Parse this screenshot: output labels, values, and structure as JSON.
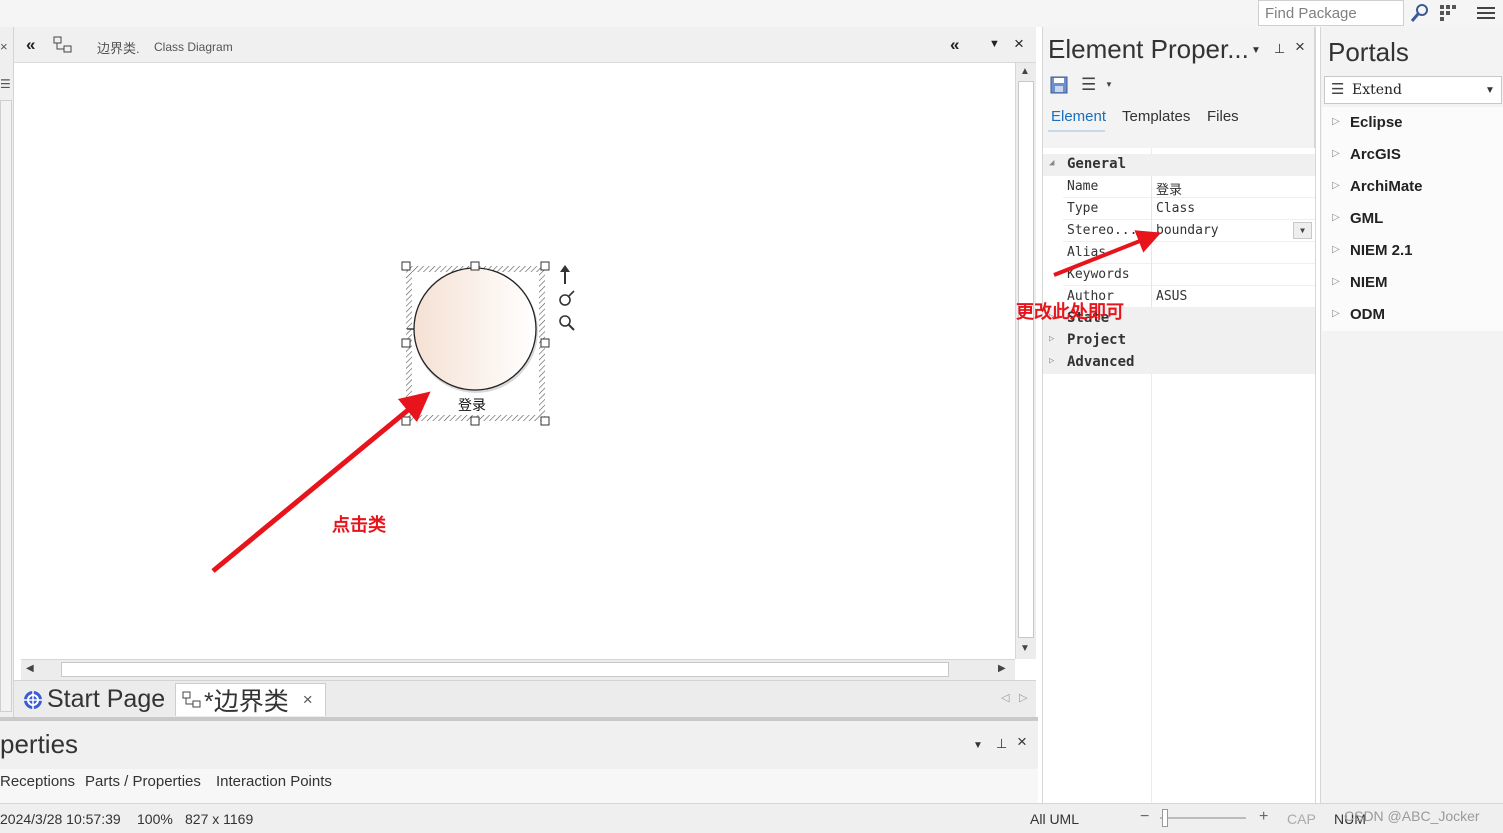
{
  "top_bar": {
    "find_placeholder": "Find Package",
    "icons": [
      "search-icon",
      "grid-icon",
      "menu-icon"
    ]
  },
  "diagram": {
    "title": "边界类.",
    "subtitle": "Class Diagram",
    "element_label": "登录"
  },
  "annotations": {
    "click_class": "点击类",
    "change_here": "更改此处即可",
    "arrow_color": "#e8141b"
  },
  "doc_tabs": {
    "start_page": "Start Page",
    "active_tab": "*边界类",
    "close": "×"
  },
  "lower_panel": {
    "title": "perties",
    "tabs": [
      "Receptions",
      "Parts / Properties",
      "Interaction Points"
    ]
  },
  "element_properties": {
    "title": "Element Proper...",
    "tabs": [
      "Element",
      "Templates",
      "Files"
    ],
    "active_tab": "Element",
    "general": "General",
    "rows": [
      {
        "key": "Name",
        "value": "登录"
      },
      {
        "key": "Type",
        "value": "Class"
      },
      {
        "key": "Stereo...",
        "value": "boundary"
      },
      {
        "key": "Alias",
        "value": ""
      },
      {
        "key": "Keywords",
        "value": ""
      },
      {
        "key": "Author",
        "value": "ASUS"
      }
    ],
    "categories": [
      "State",
      "Project",
      "Advanced"
    ]
  },
  "portals": {
    "title": "Portals",
    "dropdown_value": "Extend",
    "items": [
      "Eclipse",
      "ArcGIS",
      "ArchiMate",
      "GML",
      "NIEM 2.1",
      "NIEM",
      "ODM"
    ]
  },
  "status_bar": {
    "datetime": "2024/3/28 10:57:39",
    "zoom": "100%",
    "page_size": "827 x 1169",
    "mode": "All UML",
    "cap": "CAP",
    "num": "NUM",
    "watermark": "CSDN @ABC_Jocker"
  }
}
